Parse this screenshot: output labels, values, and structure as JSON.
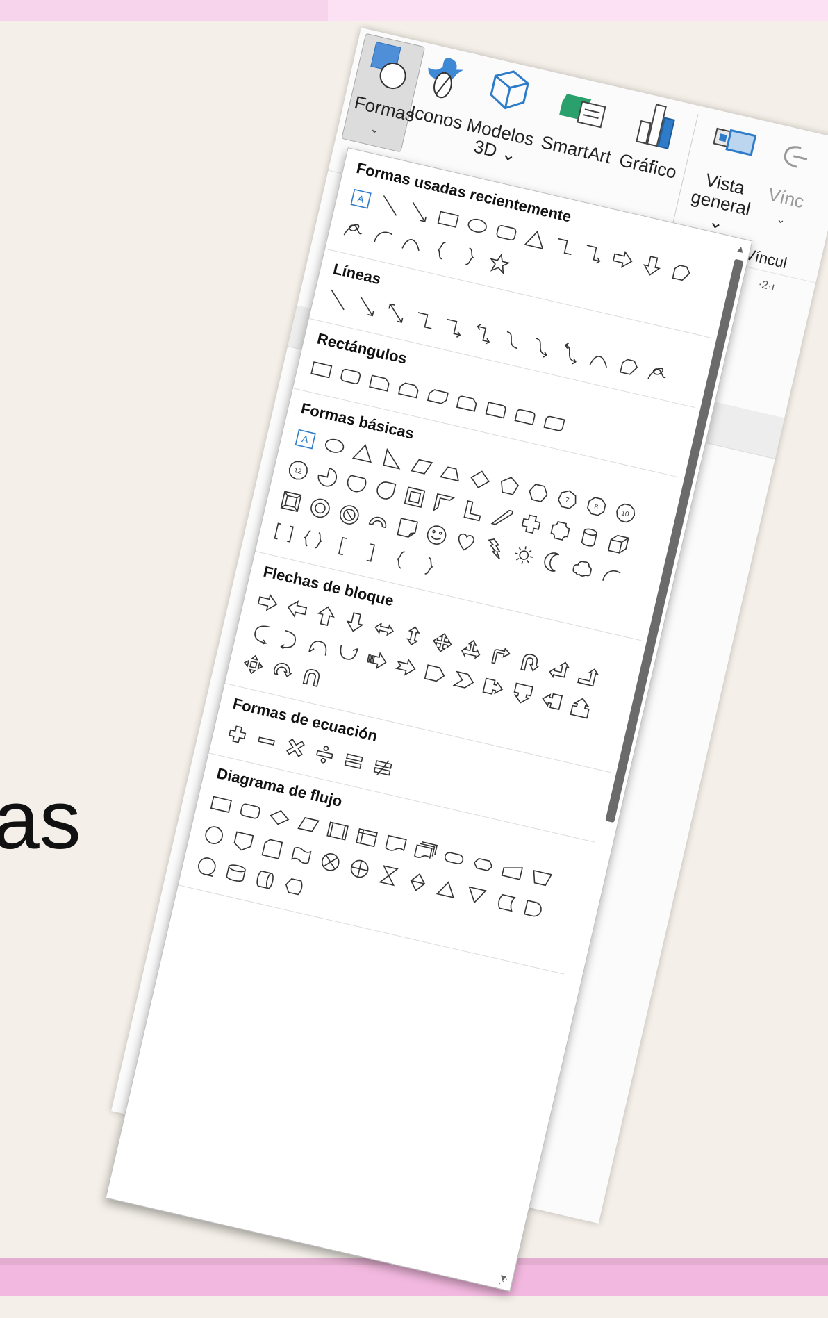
{
  "background": {
    "partial_word": "as"
  },
  "ribbon": {
    "buttons": [
      {
        "id": "formas",
        "label": "Formas",
        "sub": "⌄",
        "icon": "shapes-icon"
      },
      {
        "id": "iconos",
        "label": "Iconos",
        "sub": "",
        "icon": "bird-leaf-icon"
      },
      {
        "id": "modelos",
        "label": "Modelos",
        "sub": "3D ⌄",
        "icon": "cube-icon"
      },
      {
        "id": "smartart",
        "label": "SmartArt",
        "sub": "",
        "icon": "smartart-icon"
      },
      {
        "id": "grafico",
        "label": "Gráfico",
        "sub": "",
        "icon": "chart-icon"
      },
      {
        "id": "vista",
        "label": "Vista",
        "sub": "general ⌄",
        "icon": "overview-icon"
      },
      {
        "id": "vinc",
        "label": "Vínc",
        "sub": "⌄",
        "icon": "link-icon"
      }
    ],
    "group_label": "Víncul",
    "ruler_text": "·2·ı"
  },
  "dropdown": {
    "sections": [
      {
        "title": "Formas usadas recientemente",
        "shapes": [
          "textbox",
          "line",
          "arrow",
          "rect",
          "ellipse",
          "roundrect",
          "triangle",
          "elbow",
          "elbow-arrow",
          "right-arrow",
          "down-arrow",
          "freeform",
          "scribble",
          "arc",
          "curve",
          "left-brace",
          "right-brace",
          "star5"
        ]
      },
      {
        "title": "Líneas",
        "shapes": [
          "line",
          "arrow",
          "double-arrow",
          "elbow",
          "elbow-arrow",
          "elbow-double",
          "curve-conn",
          "curve-arrow",
          "curve-double",
          "curve",
          "freeform",
          "scribble"
        ]
      },
      {
        "title": "Rectángulos",
        "shapes": [
          "rect",
          "roundrect",
          "snip1",
          "snip2",
          "snip-diag",
          "snip-round",
          "round1",
          "round2",
          "round-diag"
        ]
      },
      {
        "title": "Formas básicas",
        "shapes": [
          "textbox",
          "ellipse",
          "triangle",
          "right-triangle",
          "parallelogram",
          "trapezoid",
          "diamond",
          "pentagon",
          "hexagon",
          "heptagon",
          "octagon",
          "decagon",
          "dodecagon",
          "pie",
          "chord",
          "teardrop",
          "frame",
          "half-frame",
          "l-shape",
          "diag-stripe",
          "plus",
          "plaque",
          "can",
          "cube",
          "bevel",
          "donut",
          "no-symbol",
          "block-arc",
          "folded",
          "smiley",
          "heart",
          "lightning",
          "sun",
          "moon",
          "cloud",
          "arc",
          "double-bracket",
          "double-brace",
          "left-bracket",
          "right-bracket",
          "left-brace",
          "right-brace"
        ]
      },
      {
        "title": "Flechas de bloque",
        "shapes": [
          "right-arrow",
          "left-arrow",
          "up-arrow",
          "down-arrow",
          "lr-arrow",
          "ud-arrow",
          "quad-arrow",
          "lru-arrow",
          "bent-arrow",
          "u-turn",
          "left-up",
          "bent-up",
          "curved-right",
          "curved-left",
          "curved-up",
          "curved-down",
          "striped-right",
          "notched-right",
          "pentagon-arrow",
          "chevron",
          "right-callout",
          "down-callout",
          "left-callout",
          "up-callout",
          "quad-callout",
          "circ-arrow",
          "u-arrow"
        ]
      },
      {
        "title": "Formas de ecuación",
        "shapes": [
          "eq-plus",
          "eq-minus",
          "eq-multiply",
          "eq-divide",
          "eq-equal",
          "eq-notequal"
        ]
      },
      {
        "title": "Diagrama de flujo",
        "shapes": [
          "fc-process",
          "fc-alt",
          "fc-decision",
          "fc-data",
          "fc-predefined",
          "fc-internal",
          "fc-document",
          "fc-multidoc",
          "fc-terminator",
          "fc-prep",
          "fc-manual-input",
          "fc-manual-op",
          "fc-connector",
          "fc-offpage",
          "fc-card",
          "fc-tape",
          "fc-sumjunction",
          "fc-or",
          "fc-collate",
          "fc-sort",
          "fc-extract",
          "fc-merge",
          "fc-stored",
          "fc-delay",
          "fc-seq",
          "fc-magdisk",
          "fc-direct",
          "fc-display"
        ]
      }
    ]
  }
}
